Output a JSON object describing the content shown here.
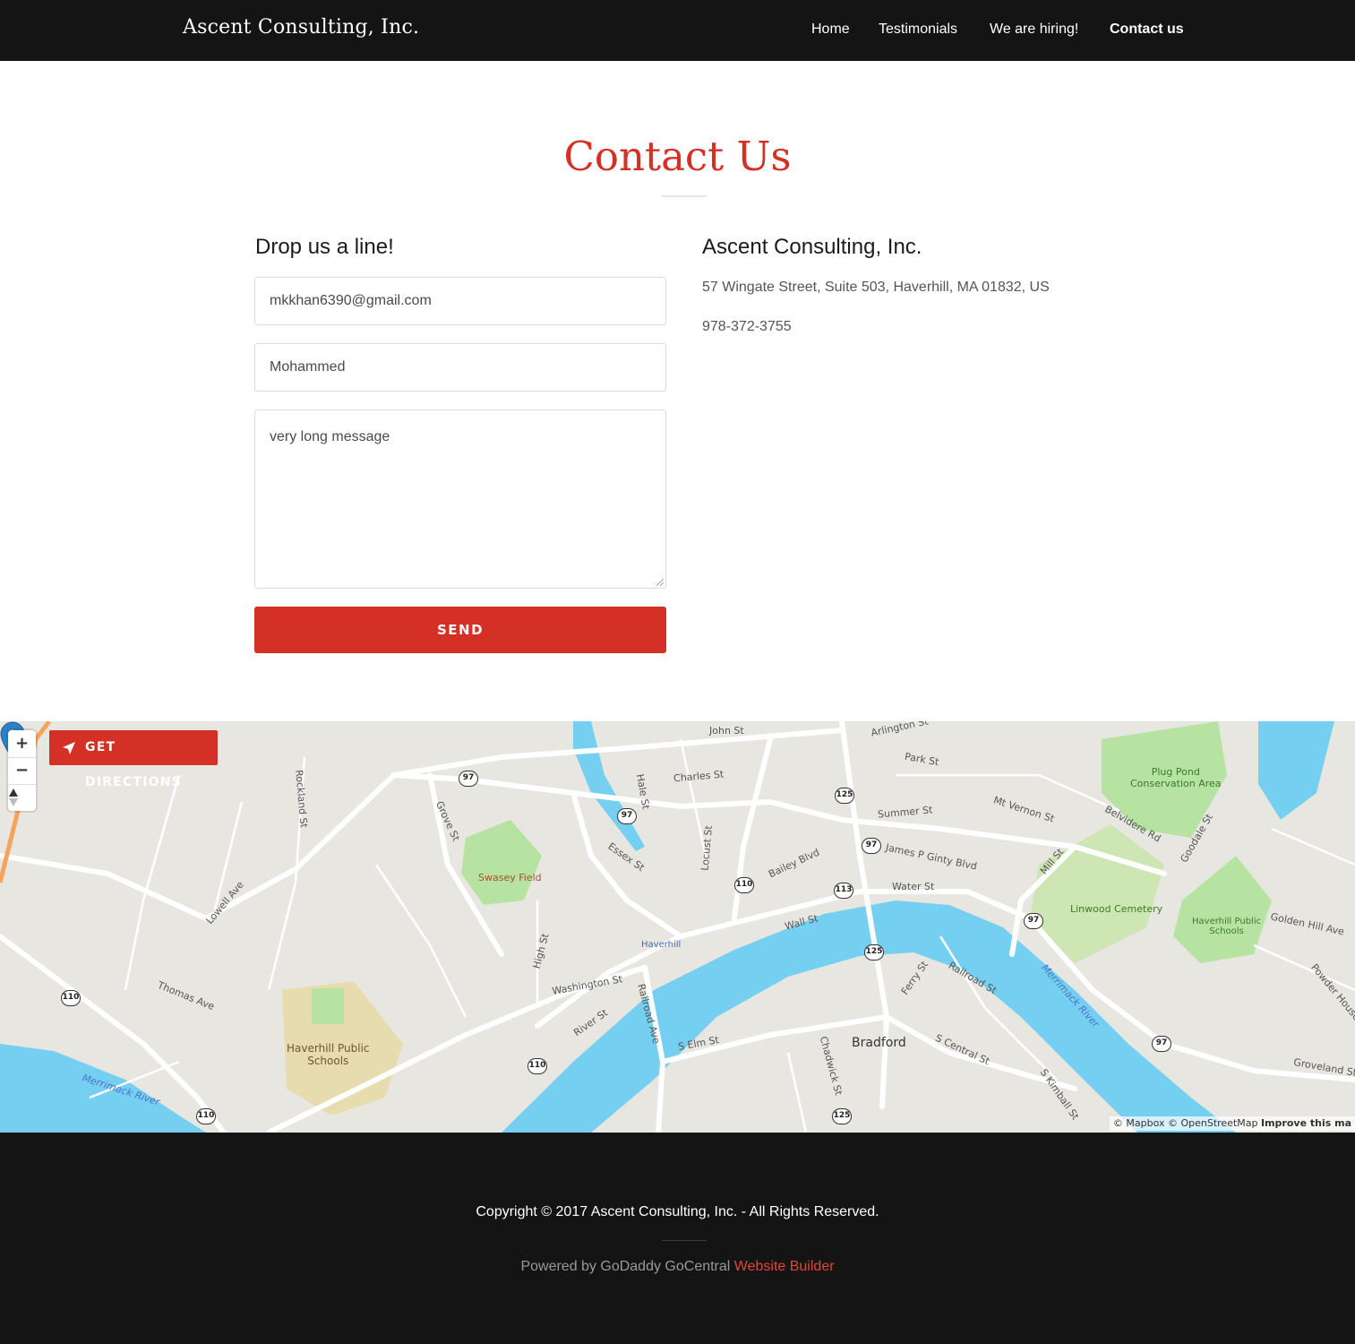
{
  "header": {
    "brand": "Ascent Consulting, Inc.",
    "nav": [
      {
        "label": "Home"
      },
      {
        "label": "Testimonials"
      },
      {
        "label": "We are hiring!"
      },
      {
        "label": "Contact us",
        "active": true
      }
    ]
  },
  "main": {
    "title": "Contact Us",
    "form": {
      "heading": "Drop us a line!",
      "email_value": "mkkhan6390@gmail.com",
      "name_value": "Mohammed",
      "message_value": "very long message",
      "send_label": "SEND"
    },
    "info": {
      "company": "Ascent Consulting, Inc.",
      "address": "57 Wingate Street, Suite 503, Haverhill, MA 01832, US",
      "phone": "978-372-3755"
    }
  },
  "map": {
    "directions_label": "GET DIRECTIONS",
    "zoom_in": "+",
    "zoom_out": "−",
    "attribution": "© Mapbox © OpenStreetMap",
    "improve": "Improve this ma",
    "labels": {
      "plug_pond": "Plug Pond\nConservation Area",
      "linwood": "Linwood Cemetery",
      "swasey": "Swasey Field",
      "schools_left": "Haverhill Public\nSchools",
      "schools_right": "Haverhill Public\nSchools",
      "bradford": "Bradford",
      "merrimack_left": "Merrimack River",
      "merrimack_right": "Merrimack River",
      "haverhill_station": "Haverhill",
      "summer_st": "Summer St",
      "water_st": "Water St",
      "james_p_ginty": "James P Ginty Blvd",
      "washington_st": "Washington St",
      "river_st": "River St",
      "essex_st": "Essex St",
      "bailey_blvd": "Bailey Blvd",
      "wall_st": "Wall St",
      "lowell_ave": "Lowell Ave",
      "s_elm_st": "S Elm St",
      "railroad_ave": "Railroad Ave",
      "groveland_st": "Groveland St",
      "golden_hill_ave": "Golden Hill Ave",
      "mt_vernon_st": "Mt Vernon St",
      "park_st": "Park St",
      "charles_st": "Charles St",
      "john_st": "John St",
      "arlington_st": "Arlington St",
      "mill_st": "Mill St",
      "thomas_ave": "Thomas Ave",
      "rockland_st": "Rockland St",
      "grove_st": "Grove St",
      "high_st": "High St",
      "locust_st": "Locust St",
      "hale_st": "Hale St",
      "belvidere_rd": "Belvidere Rd",
      "goodale_st": "Goodale St",
      "ferry_st": "Ferry St",
      "railroad_st": "Railroad St",
      "s_central_st": "S Central St",
      "s_kimball_st": "S Kimball St",
      "chadwick_st": "Chadwick St",
      "powder_house_ave": "Powder House Ave"
    },
    "shields": [
      "97",
      "97",
      "97",
      "97",
      "97",
      "125",
      "125",
      "125",
      "110",
      "110",
      "110",
      "110",
      "113"
    ]
  },
  "footer": {
    "copyright": "Copyright © 2017 Ascent Consulting, Inc. - All Rights Reserved.",
    "powered_prefix": "Powered by GoDaddy GoCentral ",
    "powered_link": "Website Builder"
  },
  "colors": {
    "accent": "#d43025",
    "header_bg": "#141414",
    "river": "#75cff0",
    "park": "#b7e3a2"
  }
}
